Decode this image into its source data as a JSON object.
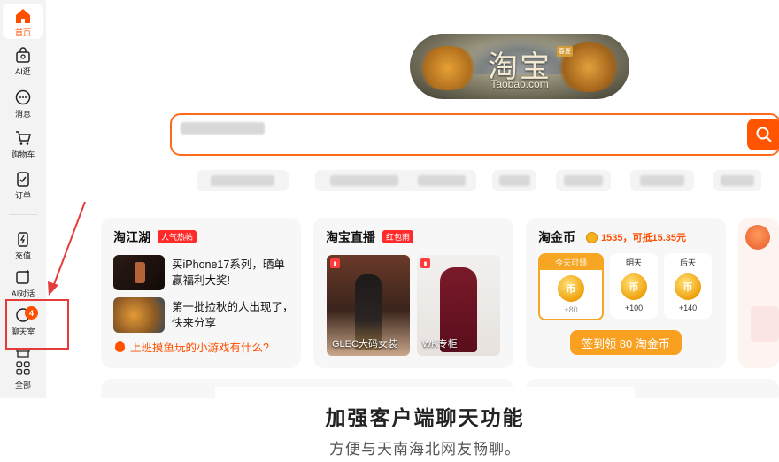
{
  "sidebar": {
    "items": [
      {
        "label": "首页",
        "icon": "home-icon"
      },
      {
        "label": "AI逛",
        "icon": "ai-bag-icon"
      },
      {
        "label": "消息",
        "icon": "message-icon"
      },
      {
        "label": "购物车",
        "icon": "cart-icon"
      },
      {
        "label": "订单",
        "icon": "order-icon"
      },
      {
        "label": "充值",
        "icon": "recharge-icon"
      },
      {
        "label": "AI对话",
        "icon": "ai-chat-icon"
      },
      {
        "label": "聊天室",
        "icon": "chatroom-icon",
        "badge": "4"
      },
      {
        "label": "全部",
        "icon": "grid-icon"
      }
    ]
  },
  "logo": {
    "main": "淘宝",
    "sub": "Taobao.com",
    "tag": "春夏"
  },
  "cards": {
    "jianghu": {
      "title": "淘江湖",
      "pill": "人气热帖",
      "posts": [
        "买iPhone17系列，晒单赢福利大奖!",
        "第一批捡秋的人出现了，快来分享"
      ],
      "link": "上班摸鱼玩的小游戏有什么?"
    },
    "live": {
      "title": "淘宝直播",
      "pill": "红包雨",
      "items": [
        {
          "caption": "GLEC大码女装"
        },
        {
          "caption": "WK专柜"
        }
      ]
    },
    "coins": {
      "title": "淘金币",
      "info": "1535，可抵15.35元",
      "days": [
        {
          "label": "今天可领",
          "amount": "+80"
        },
        {
          "label": "明天",
          "amount": "+100"
        },
        {
          "label": "后天",
          "amount": "+140"
        }
      ],
      "sign_button": "签到领 80 淘金币"
    }
  },
  "caption": {
    "main": "加强客户端聊天功能",
    "sub": "方便与天南海北网友畅聊。"
  },
  "colors": {
    "accent": "#ff5000",
    "annotation": "#e43b3b",
    "coin": "#f6a623"
  }
}
